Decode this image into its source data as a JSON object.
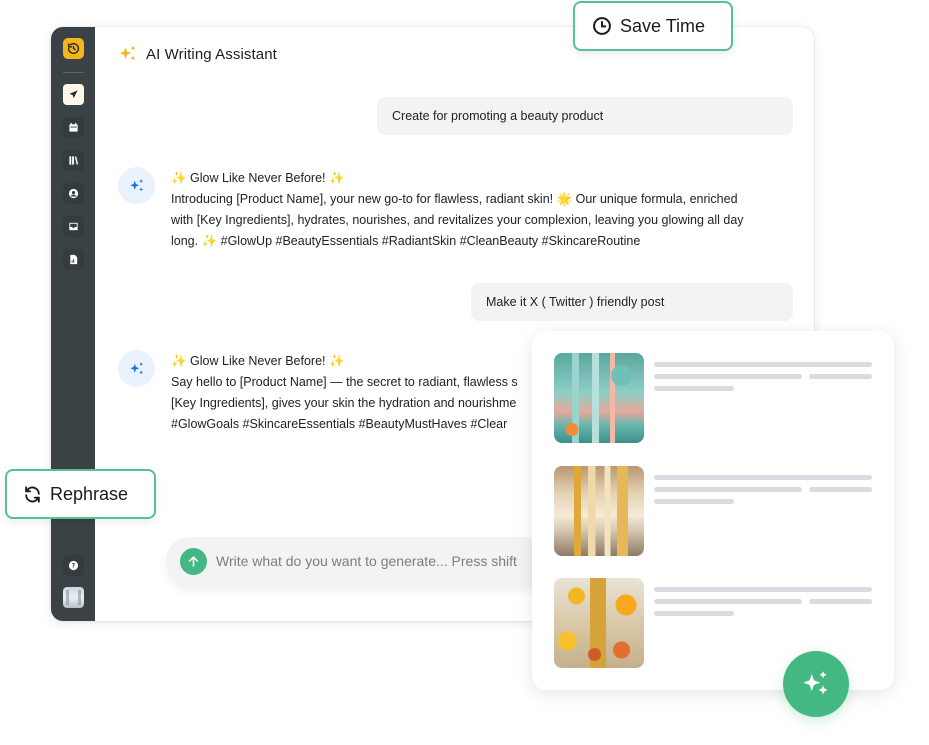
{
  "app": {
    "title": "AI Writing Assistant",
    "accent_color": "#43b883",
    "logo_color": "#f6b61b"
  },
  "sidebar": {
    "items": [
      {
        "name": "send",
        "icon": "send-icon",
        "active": true
      },
      {
        "name": "calendar",
        "icon": "calendar-icon",
        "active": false
      },
      {
        "name": "library",
        "icon": "library-icon",
        "active": false
      },
      {
        "name": "account",
        "icon": "user-circle-icon",
        "active": false
      },
      {
        "name": "inbox",
        "icon": "inbox-icon",
        "active": false
      },
      {
        "name": "reports",
        "icon": "report-icon",
        "active": false
      }
    ],
    "help_icon": "help-icon",
    "avatar": "user-avatar"
  },
  "chat": {
    "messages": [
      {
        "role": "user",
        "text": "Create for promoting a beauty product"
      },
      {
        "role": "assistant",
        "lines": [
          "✨ Glow Like Never Before! ✨",
          "Introducing [Product Name], your new go-to for flawless, radiant skin! 🌟 Our unique formula, enriched",
          "with [Key Ingredients], hydrates, nourishes, and revitalizes your complexion, leaving you glowing all day",
          "long. ✨ #GlowUp #BeautyEssentials #RadiantSkin #CleanBeauty #SkincareRoutine"
        ]
      },
      {
        "role": "user",
        "text": "Make it X ( Twitter ) friendly post"
      },
      {
        "role": "assistant",
        "lines": [
          "✨ Glow Like Never Before! ✨",
          "Say hello to [Product Name] — the secret to radiant, flawless s",
          "[Key Ingredients], gives your skin the hydration and nourishme",
          "#GlowGoals #SkincareEssentials #BeautyMustHaves #Clear"
        ]
      }
    ]
  },
  "composer": {
    "placeholder": "Write what do you want to generate... Press shift"
  },
  "badges": {
    "save_time": "Save Time",
    "rephrase": "Rephrase"
  },
  "results": {
    "items": [
      {
        "image": "teal skincare bottles with orange flowers"
      },
      {
        "image": "gold cosmetic jars on marble vanity"
      },
      {
        "image": "serum bottle among yellow flowers"
      }
    ]
  }
}
